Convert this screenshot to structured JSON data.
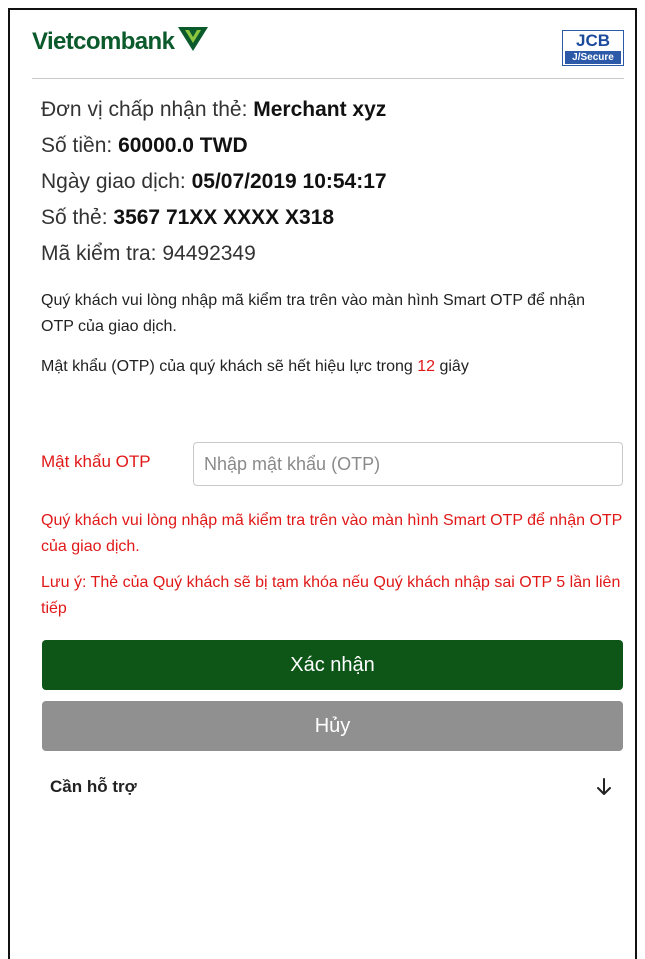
{
  "header": {
    "bank_name": "Vietcombank",
    "badge": {
      "top": "JCB",
      "bottom": "J/Secure"
    }
  },
  "transaction": {
    "merchant": {
      "label": "Đơn vị chấp nhận thẻ: ",
      "value": "Merchant xyz"
    },
    "amount": {
      "label": "Số tiền: ",
      "value": "60000.0 TWD"
    },
    "date": {
      "label": "Ngày giao dịch: ",
      "value": "05/07/2019 10:54:17"
    },
    "card": {
      "label": "Số thẻ: ",
      "value": "3567 71XX XXXX X318"
    },
    "check_code": {
      "label": "Mã kiểm tra: ",
      "value": "94492349"
    }
  },
  "messages": {
    "instruction": "Quý khách vui lòng nhập mã kiểm tra trên vào màn hình Smart OTP để nhận OTP của giao dịch.",
    "expiry_prefix": "Mật khẩu (OTP) của quý khách sẽ hết hiệu lực trong ",
    "expiry_seconds": "12",
    "expiry_suffix": " giây"
  },
  "otp": {
    "label": "Mật khẩu OTP",
    "placeholder": "Nhập mật khẩu (OTP)",
    "value": ""
  },
  "warnings": {
    "instruction": "Quý khách vui lòng nhập mã kiểm tra trên vào màn hình Smart OTP để nhận OTP của giao dịch.",
    "lock_notice": "Lưu ý: Thẻ của Quý khách sẽ bị tạm khóa nếu Quý khách nhập sai OTP 5 lần liên tiếp"
  },
  "buttons": {
    "confirm": "Xác nhận",
    "cancel": "Hủy"
  },
  "support": {
    "label": "Cần hỗ trợ",
    "icon": "arrow-down-icon"
  },
  "colors": {
    "brand_green": "#0d5618",
    "error_red": "#e01818",
    "cancel_gray": "#909090"
  }
}
